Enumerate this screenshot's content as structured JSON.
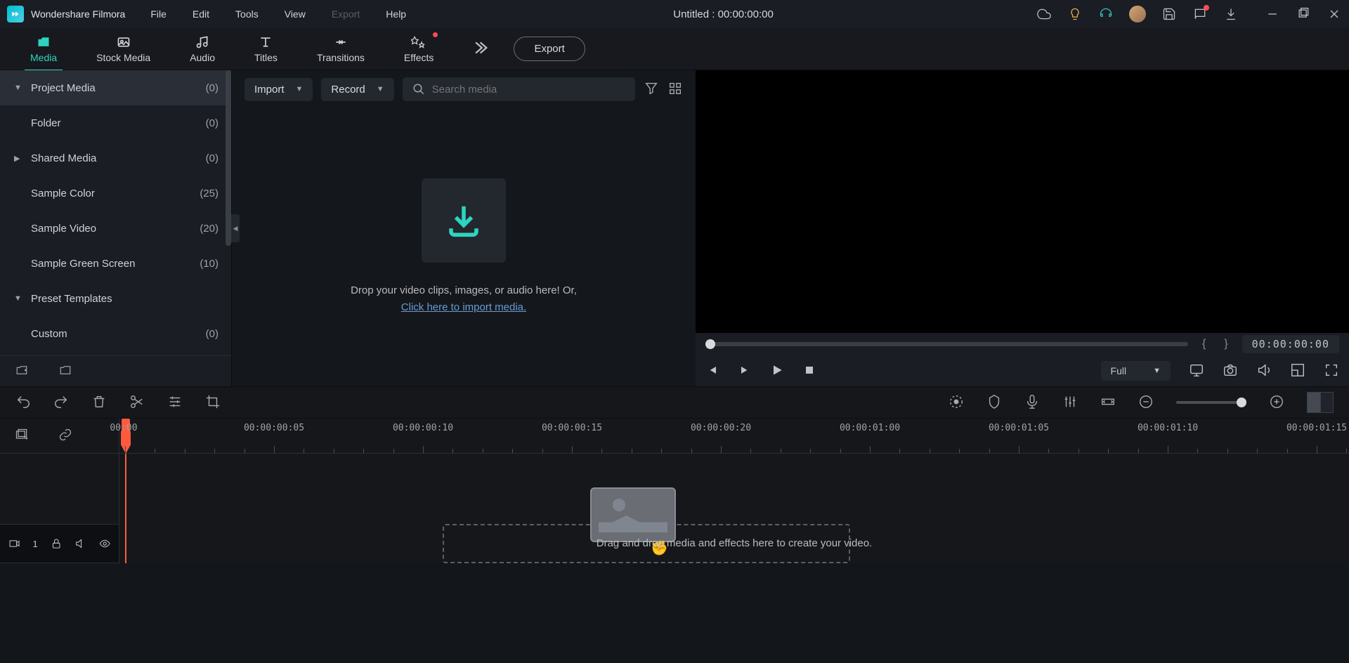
{
  "app": {
    "name": "Wondershare Filmora",
    "title": "Untitled : 00:00:00:00"
  },
  "menu": {
    "file": "File",
    "edit": "Edit",
    "tools": "Tools",
    "view": "View",
    "export": "Export",
    "help": "Help"
  },
  "tabs": {
    "media": "Media",
    "stock": "Stock Media",
    "audio": "Audio",
    "titles": "Titles",
    "transitions": "Transitions",
    "effects": "Effects",
    "export_btn": "Export"
  },
  "sidebar": {
    "items": [
      {
        "label": "Project Media",
        "count": "(0)",
        "arrow": "▼",
        "indent": 0
      },
      {
        "label": "Folder",
        "count": "(0)",
        "arrow": "",
        "indent": 1
      },
      {
        "label": "Shared Media",
        "count": "(0)",
        "arrow": "▶",
        "indent": 0
      },
      {
        "label": "Sample Color",
        "count": "(25)",
        "arrow": "",
        "indent": 0
      },
      {
        "label": "Sample Video",
        "count": "(20)",
        "arrow": "",
        "indent": 0
      },
      {
        "label": "Sample Green Screen",
        "count": "(10)",
        "arrow": "",
        "indent": 0
      },
      {
        "label": "Preset Templates",
        "count": "",
        "arrow": "▼",
        "indent": 0
      },
      {
        "label": "Custom",
        "count": "(0)",
        "arrow": "",
        "indent": 1
      }
    ]
  },
  "media": {
    "import": "Import",
    "record": "Record",
    "search_placeholder": "Search media",
    "drop_line1": "Drop your video clips, images, or audio here! Or,",
    "drop_link": "Click here to import media."
  },
  "preview": {
    "time": "00:00:00:00",
    "quality": "Full",
    "mark_in": "{",
    "mark_out": "}"
  },
  "timeline": {
    "ticks": [
      "00:00",
      "00:00:00:05",
      "00:00:00:10",
      "00:00:00:15",
      "00:00:00:20",
      "00:00:01:00",
      "00:00:01:05",
      "00:00:01:10",
      "00:00:01:15"
    ],
    "track_num": "1",
    "hint": "Drag and drop media and effects here to create your video."
  }
}
